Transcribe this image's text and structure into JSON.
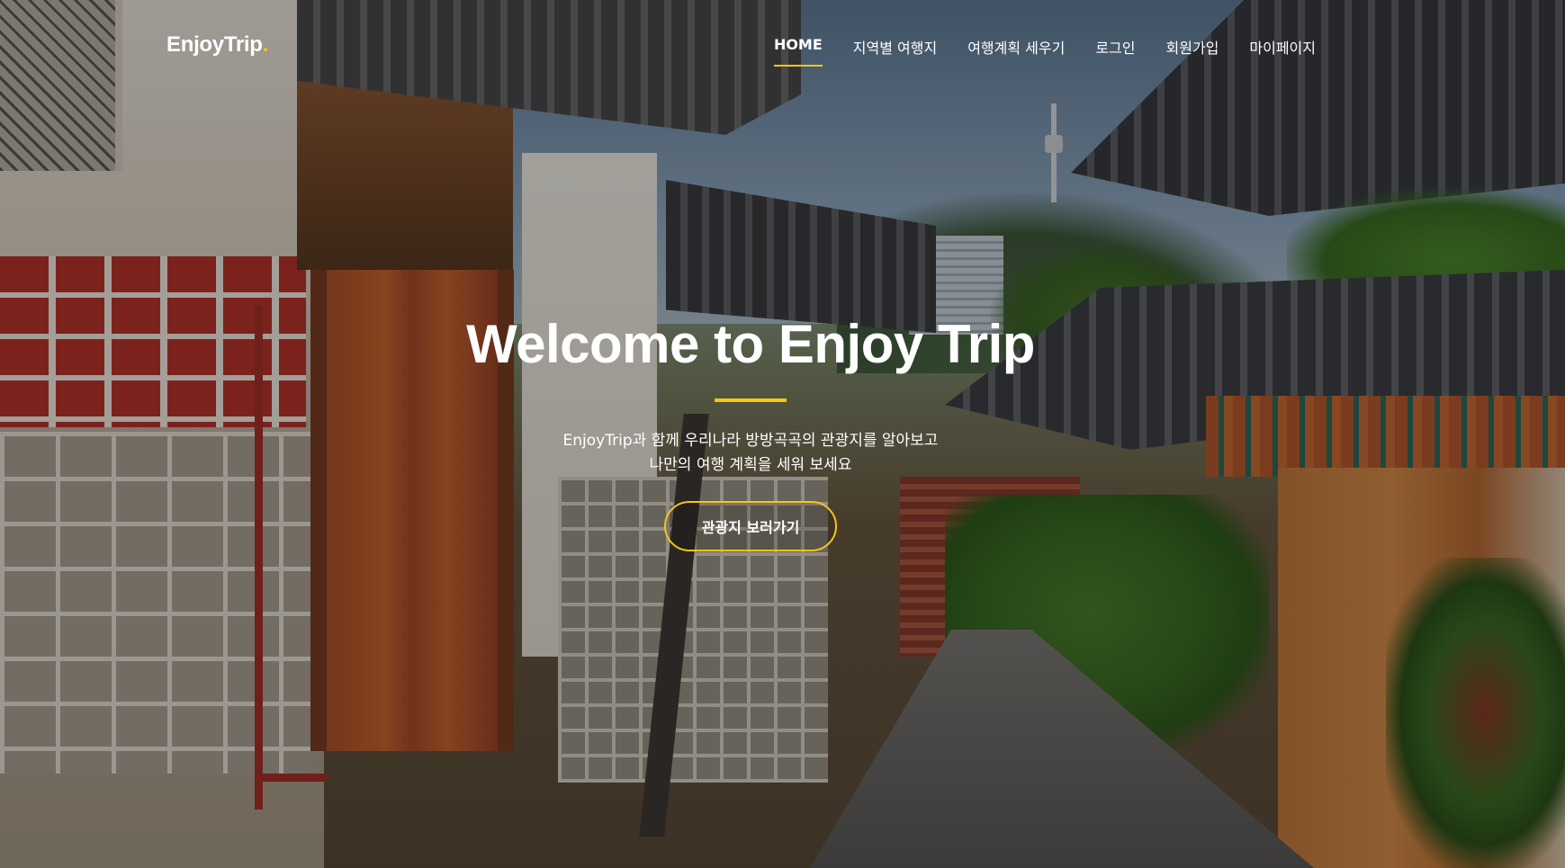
{
  "header": {
    "logo": {
      "text": "EnjoyTrip",
      "dot": "."
    },
    "nav": [
      {
        "label": "HOME",
        "active": true
      },
      {
        "label": "지역별 여행지"
      },
      {
        "label": "여행계획 세우기"
      },
      {
        "label": "로그인"
      },
      {
        "label": "회원가입"
      },
      {
        "label": "마이페이지"
      }
    ]
  },
  "hero": {
    "title": "Welcome to Enjoy Trip",
    "subtitle_line1": "EnjoyTrip과 함께 우리나라 방방곡곡의 관광지를 알아보고",
    "subtitle_line2": "나만의 여행 계획을 세워 보세요",
    "cta_label": "관광지 보러가기"
  },
  "colors": {
    "accent": "#f5c518",
    "text": "#ffffff"
  }
}
